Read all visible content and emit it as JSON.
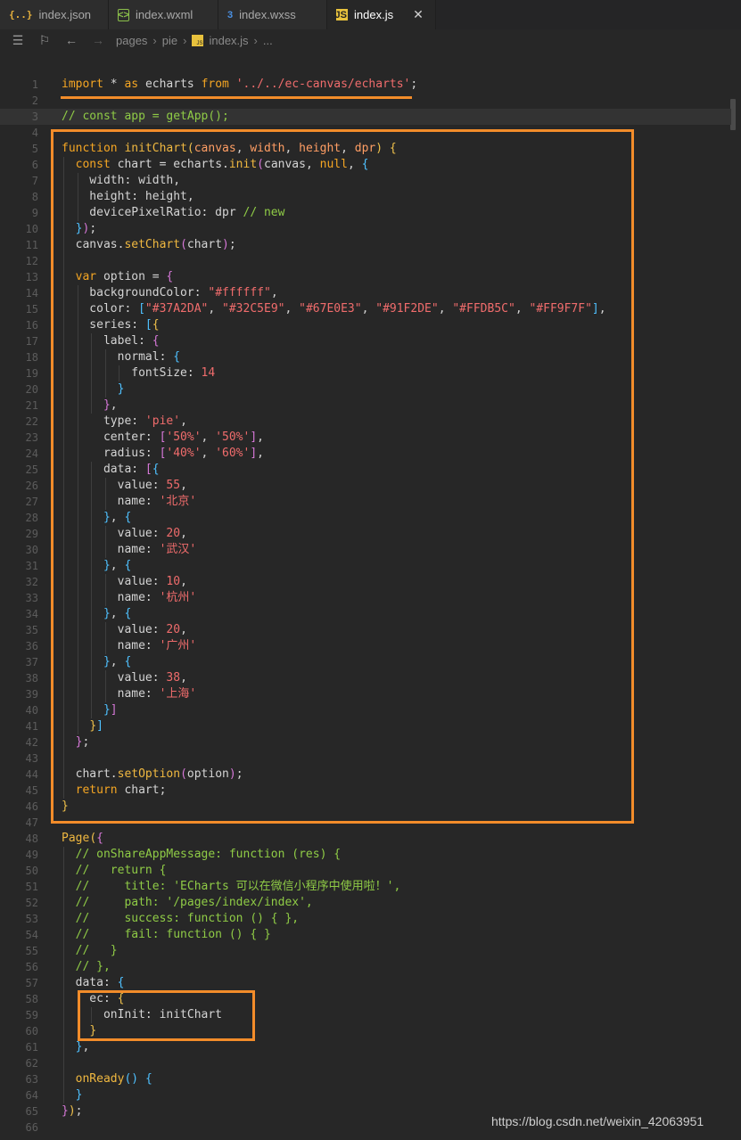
{
  "tabs": [
    {
      "label": "index.json",
      "icon": "json-file-icon",
      "glyph": "{..}",
      "active": false
    },
    {
      "label": "index.wxml",
      "icon": "wxml-file-icon",
      "glyph": "<>",
      "active": false
    },
    {
      "label": "index.wxss",
      "icon": "css3-file-icon",
      "glyph": "3",
      "active": false
    },
    {
      "label": "index.js",
      "icon": "js-file-icon",
      "glyph": "JS",
      "active": true
    }
  ],
  "breadcrumb": [
    "pages",
    "pie",
    "index.js",
    "..."
  ],
  "watermark": "https://blog.csdn.net/weixin_42063951",
  "lines": [
    [
      [
        "kw",
        "import "
      ],
      [
        "op",
        "* "
      ],
      [
        "kw",
        "as "
      ],
      [
        "plain",
        "echarts "
      ],
      [
        "kw",
        "from "
      ],
      [
        "str",
        "'../../ec-canvas/echarts'"
      ],
      [
        "plain",
        ";"
      ]
    ],
    [],
    [
      [
        "cm",
        "// const app = getApp();"
      ]
    ],
    [],
    [
      [
        "kw",
        "function "
      ],
      [
        "fn",
        "initChart"
      ],
      [
        "b1",
        "("
      ],
      [
        "par",
        "canvas"
      ],
      [
        "plain",
        ", "
      ],
      [
        "par",
        "width"
      ],
      [
        "plain",
        ", "
      ],
      [
        "par",
        "height"
      ],
      [
        "plain",
        ", "
      ],
      [
        "par",
        "dpr"
      ],
      [
        "b1",
        ")"
      ],
      [
        "plain",
        " "
      ],
      [
        "b1",
        "{"
      ]
    ],
    [
      [
        "plain",
        "  "
      ],
      [
        "kw",
        "const "
      ],
      [
        "plain",
        "chart = echarts."
      ],
      [
        "fn",
        "init"
      ],
      [
        "b2",
        "("
      ],
      [
        "plain",
        "canvas, "
      ],
      [
        "kw",
        "null"
      ],
      [
        "plain",
        ", "
      ],
      [
        "b3",
        "{"
      ]
    ],
    [
      [
        "plain",
        "    width: width,"
      ]
    ],
    [
      [
        "plain",
        "    height: height,"
      ]
    ],
    [
      [
        "plain",
        "    devicePixelRatio: dpr "
      ],
      [
        "cm",
        "// new"
      ]
    ],
    [
      [
        "plain",
        "  "
      ],
      [
        "b3",
        "}"
      ],
      [
        "b2",
        ")"
      ],
      [
        "plain",
        ";"
      ]
    ],
    [
      [
        "plain",
        "  canvas."
      ],
      [
        "fn",
        "setChart"
      ],
      [
        "b2",
        "("
      ],
      [
        "plain",
        "chart"
      ],
      [
        "b2",
        ")"
      ],
      [
        "plain",
        ";"
      ]
    ],
    [],
    [
      [
        "plain",
        "  "
      ],
      [
        "kw",
        "var "
      ],
      [
        "plain",
        "option = "
      ],
      [
        "b2",
        "{"
      ]
    ],
    [
      [
        "plain",
        "    backgroundColor: "
      ],
      [
        "str",
        "\"#ffffff\""
      ],
      [
        "plain",
        ","
      ]
    ],
    [
      [
        "plain",
        "    color: "
      ],
      [
        "b3",
        "["
      ],
      [
        "str",
        "\"#37A2DA\""
      ],
      [
        "plain",
        ", "
      ],
      [
        "str",
        "\"#32C5E9\""
      ],
      [
        "plain",
        ", "
      ],
      [
        "str",
        "\"#67E0E3\""
      ],
      [
        "plain",
        ", "
      ],
      [
        "str",
        "\"#91F2DE\""
      ],
      [
        "plain",
        ", "
      ],
      [
        "str",
        "\"#FFDB5C\""
      ],
      [
        "plain",
        ", "
      ],
      [
        "str",
        "\"#FF9F7F\""
      ],
      [
        "b3",
        "]"
      ],
      [
        "plain",
        ","
      ]
    ],
    [
      [
        "plain",
        "    series: "
      ],
      [
        "b3",
        "["
      ],
      [
        "b1",
        "{"
      ]
    ],
    [
      [
        "plain",
        "      label: "
      ],
      [
        "b2",
        "{"
      ]
    ],
    [
      [
        "plain",
        "        normal: "
      ],
      [
        "b3",
        "{"
      ]
    ],
    [
      [
        "plain",
        "          fontSize: "
      ],
      [
        "num",
        "14"
      ]
    ],
    [
      [
        "plain",
        "        "
      ],
      [
        "b3",
        "}"
      ]
    ],
    [
      [
        "plain",
        "      "
      ],
      [
        "b2",
        "}"
      ],
      [
        "plain",
        ","
      ]
    ],
    [
      [
        "plain",
        "      type: "
      ],
      [
        "str",
        "'pie'"
      ],
      [
        "plain",
        ","
      ]
    ],
    [
      [
        "plain",
        "      center: "
      ],
      [
        "b2",
        "["
      ],
      [
        "str",
        "'50%'"
      ],
      [
        "plain",
        ", "
      ],
      [
        "str",
        "'50%'"
      ],
      [
        "b2",
        "]"
      ],
      [
        "plain",
        ","
      ]
    ],
    [
      [
        "plain",
        "      radius: "
      ],
      [
        "b2",
        "["
      ],
      [
        "str",
        "'40%'"
      ],
      [
        "plain",
        ", "
      ],
      [
        "str",
        "'60%'"
      ],
      [
        "b2",
        "]"
      ],
      [
        "plain",
        ","
      ]
    ],
    [
      [
        "plain",
        "      data: "
      ],
      [
        "b2",
        "["
      ],
      [
        "b3",
        "{"
      ]
    ],
    [
      [
        "plain",
        "        value: "
      ],
      [
        "num",
        "55"
      ],
      [
        "plain",
        ","
      ]
    ],
    [
      [
        "plain",
        "        name: "
      ],
      [
        "str",
        "'北京'"
      ]
    ],
    [
      [
        "plain",
        "      "
      ],
      [
        "b3",
        "}"
      ],
      [
        "plain",
        ", "
      ],
      [
        "b3",
        "{"
      ]
    ],
    [
      [
        "plain",
        "        value: "
      ],
      [
        "num",
        "20"
      ],
      [
        "plain",
        ","
      ]
    ],
    [
      [
        "plain",
        "        name: "
      ],
      [
        "str",
        "'武汉'"
      ]
    ],
    [
      [
        "plain",
        "      "
      ],
      [
        "b3",
        "}"
      ],
      [
        "plain",
        ", "
      ],
      [
        "b3",
        "{"
      ]
    ],
    [
      [
        "plain",
        "        value: "
      ],
      [
        "num",
        "10"
      ],
      [
        "plain",
        ","
      ]
    ],
    [
      [
        "plain",
        "        name: "
      ],
      [
        "str",
        "'杭州'"
      ]
    ],
    [
      [
        "plain",
        "      "
      ],
      [
        "b3",
        "}"
      ],
      [
        "plain",
        ", "
      ],
      [
        "b3",
        "{"
      ]
    ],
    [
      [
        "plain",
        "        value: "
      ],
      [
        "num",
        "20"
      ],
      [
        "plain",
        ","
      ]
    ],
    [
      [
        "plain",
        "        name: "
      ],
      [
        "str",
        "'广州'"
      ]
    ],
    [
      [
        "plain",
        "      "
      ],
      [
        "b3",
        "}"
      ],
      [
        "plain",
        ", "
      ],
      [
        "b3",
        "{"
      ]
    ],
    [
      [
        "plain",
        "        value: "
      ],
      [
        "num",
        "38"
      ],
      [
        "plain",
        ","
      ]
    ],
    [
      [
        "plain",
        "        name: "
      ],
      [
        "str",
        "'上海'"
      ]
    ],
    [
      [
        "plain",
        "      "
      ],
      [
        "b3",
        "}"
      ],
      [
        "b2",
        "]"
      ]
    ],
    [
      [
        "plain",
        "    "
      ],
      [
        "b1",
        "}"
      ],
      [
        "b3",
        "]"
      ]
    ],
    [
      [
        "plain",
        "  "
      ],
      [
        "b2",
        "}"
      ],
      [
        "plain",
        ";"
      ]
    ],
    [],
    [
      [
        "plain",
        "  chart."
      ],
      [
        "fn",
        "setOption"
      ],
      [
        "b2",
        "("
      ],
      [
        "plain",
        "option"
      ],
      [
        "b2",
        ")"
      ],
      [
        "plain",
        ";"
      ]
    ],
    [
      [
        "plain",
        "  "
      ],
      [
        "kw",
        "return "
      ],
      [
        "plain",
        "chart;"
      ]
    ],
    [
      [
        "b1",
        "}"
      ]
    ],
    [],
    [
      [
        "fn",
        "Page"
      ],
      [
        "b1",
        "("
      ],
      [
        "b2",
        "{"
      ]
    ],
    [
      [
        "cm",
        "  // onShareAppMessage: function (res) {"
      ]
    ],
    [
      [
        "cm",
        "  //   return {"
      ]
    ],
    [
      [
        "cm",
        "  //     title: 'ECharts 可以在微信小程序中使用啦！',"
      ]
    ],
    [
      [
        "cm",
        "  //     path: '/pages/index/index',"
      ]
    ],
    [
      [
        "cm",
        "  //     success: function () { },"
      ]
    ],
    [
      [
        "cm",
        "  //     fail: function () { }"
      ]
    ],
    [
      [
        "cm",
        "  //   }"
      ]
    ],
    [
      [
        "cm",
        "  // },"
      ]
    ],
    [
      [
        "plain",
        "  data: "
      ],
      [
        "b3",
        "{"
      ]
    ],
    [
      [
        "plain",
        "    ec: "
      ],
      [
        "b1",
        "{"
      ]
    ],
    [
      [
        "plain",
        "      onInit: initChart"
      ]
    ],
    [
      [
        "plain",
        "    "
      ],
      [
        "b1",
        "}"
      ]
    ],
    [
      [
        "plain",
        "  "
      ],
      [
        "b3",
        "}"
      ],
      [
        "plain",
        ","
      ]
    ],
    [],
    [
      [
        "plain",
        "  "
      ],
      [
        "fn",
        "onReady"
      ],
      [
        "b3",
        "()"
      ],
      [
        "plain",
        " "
      ],
      [
        "b3",
        "{"
      ]
    ],
    [
      [
        "plain",
        "  "
      ],
      [
        "b3",
        "}"
      ]
    ],
    [
      [
        "b2",
        "}"
      ],
      [
        "b1",
        ")"
      ],
      [
        "plain",
        ";"
      ]
    ],
    []
  ],
  "highlighted_line": 3
}
